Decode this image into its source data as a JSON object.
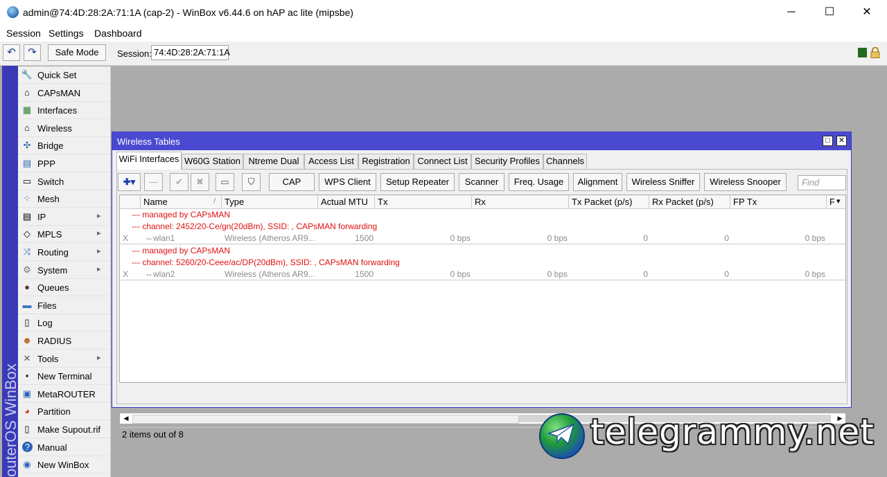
{
  "window": {
    "title": "admin@74:4D:28:2A:71:1A (cap-2) - WinBox v6.44.6 on hAP ac lite (mipsbe)",
    "minimize": "─",
    "maximize": "☐",
    "close": "✕"
  },
  "menu": [
    "Session",
    "Settings",
    "Dashboard"
  ],
  "toolbar": {
    "undo": "↶",
    "redo": "↷",
    "safe_mode": "Safe Mode",
    "session_label": "Session:",
    "session_value": "74:4D:28:2A:71:1A"
  },
  "side_strip": "outerOS WinBox",
  "sidebar": [
    {
      "label": "Quick Set",
      "icon": "🔧",
      "submenu": false
    },
    {
      "label": "CAPsMAN",
      "icon": "⌂",
      "submenu": false
    },
    {
      "label": "Interfaces",
      "icon": "▦",
      "submenu": false
    },
    {
      "label": "Wireless",
      "icon": "⌂",
      "submenu": false
    },
    {
      "label": "Bridge",
      "icon": "✣",
      "submenu": false
    },
    {
      "label": "PPP",
      "icon": "▤",
      "submenu": false
    },
    {
      "label": "Switch",
      "icon": "▭",
      "submenu": false
    },
    {
      "label": "Mesh",
      "icon": "⁘",
      "submenu": false
    },
    {
      "label": "IP",
      "icon": "▤",
      "submenu": true
    },
    {
      "label": "MPLS",
      "icon": "◇",
      "submenu": true
    },
    {
      "label": "Routing",
      "icon": "⤨",
      "submenu": true
    },
    {
      "label": "System",
      "icon": "⚙",
      "submenu": true
    },
    {
      "label": "Queues",
      "icon": "●",
      "submenu": false
    },
    {
      "label": "Files",
      "icon": "▬",
      "submenu": false
    },
    {
      "label": "Log",
      "icon": "▯",
      "submenu": false
    },
    {
      "label": "RADIUS",
      "icon": "☻",
      "submenu": false
    },
    {
      "label": "Tools",
      "icon": "✕",
      "submenu": true
    },
    {
      "label": "New Terminal",
      "icon": "▪",
      "submenu": false
    },
    {
      "label": "MetaROUTER",
      "icon": "▣",
      "submenu": false
    },
    {
      "label": "Partition",
      "icon": "◕",
      "submenu": false
    },
    {
      "label": "Make Supout.rif",
      "icon": "▯",
      "submenu": false
    },
    {
      "label": "Manual",
      "icon": "?",
      "submenu": false
    },
    {
      "label": "New WinBox",
      "icon": "◉",
      "submenu": false
    }
  ],
  "submenu_arrow": "▸",
  "wireless": {
    "title": "Wireless Tables",
    "restore": "□",
    "close": "✕",
    "tabs": [
      "WiFi Interfaces",
      "W60G Station",
      "Ntreme Dual",
      "Access List",
      "Registration",
      "Connect List",
      "Security Profiles",
      "Channels"
    ],
    "actions": {
      "add": "✚▾",
      "remove": "—",
      "enable": "✔",
      "disable": "✖",
      "comment": "▭",
      "filter": "⛉",
      "buttons": [
        "CAP",
        "WPS Client",
        "Setup Repeater",
        "Scanner",
        "Freq. Usage",
        "Alignment",
        "Wireless Sniffer",
        "Wireless Snooper"
      ],
      "find_placeholder": "Find"
    },
    "columns": [
      "Name",
      "Type",
      "Actual MTU",
      "Tx",
      "Rx",
      "Tx Packet (p/s)",
      "Rx Packet (p/s)",
      "FP Tx",
      "FI"
    ],
    "sort_marker": "/",
    "col_menu": "▾",
    "groups": [
      {
        "comments": [
          "--- managed by CAPsMAN",
          "--- channel: 2452/20-Ce/gn(20dBm), SSID: , CAPsMAN forwarding"
        ],
        "row": {
          "flag": "X",
          "name": "⇔wlan1",
          "type": "Wireless (Atheros AR9...",
          "mtu": "1500",
          "tx": "0 bps",
          "rx": "0 bps",
          "txp": "0",
          "rxp": "0",
          "fptx": "0 bps"
        }
      },
      {
        "comments": [
          "--- managed by CAPsMAN",
          "--- channel: 5260/20-Ceee/ac/DP(20dBm), SSID: , CAPsMAN forwarding"
        ],
        "row": {
          "flag": "X",
          "name": "⇔wlan2",
          "type": "Wireless (Atheros AR9...",
          "mtu": "1500",
          "tx": "0 bps",
          "rx": "0 bps",
          "txp": "0",
          "rxp": "0",
          "fptx": "0 bps"
        }
      }
    ],
    "scroll_left": "◀",
    "scroll_right": "▶",
    "status": "2 items out of 8"
  },
  "watermark": "telegrammy.net"
}
